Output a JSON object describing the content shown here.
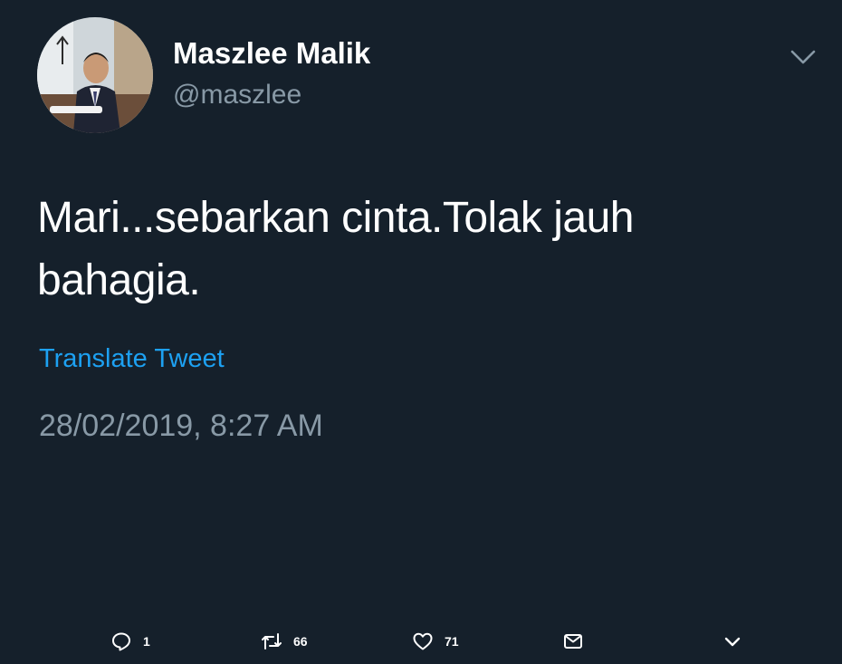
{
  "tweet": {
    "author": {
      "display_name": "Maszlee Malik",
      "handle": "@maszlee"
    },
    "text": "Mari...sebarkan cinta.Tolak jauh bahagia.",
    "translate_label": "Translate Tweet",
    "timestamp": "28/02/2019, 8:27 AM",
    "actions": {
      "reply": {
        "icon": "reply-icon",
        "count": "1"
      },
      "retweet": {
        "icon": "retweet-icon",
        "count": "66"
      },
      "like": {
        "icon": "heart-icon",
        "count": "71"
      },
      "message": {
        "icon": "envelope-icon"
      },
      "more": {
        "icon": "chevron-down-icon"
      }
    }
  },
  "colors": {
    "background": "#15202b",
    "primary_text": "#ffffff",
    "secondary_text": "#8899a6",
    "link": "#1da1f2"
  }
}
